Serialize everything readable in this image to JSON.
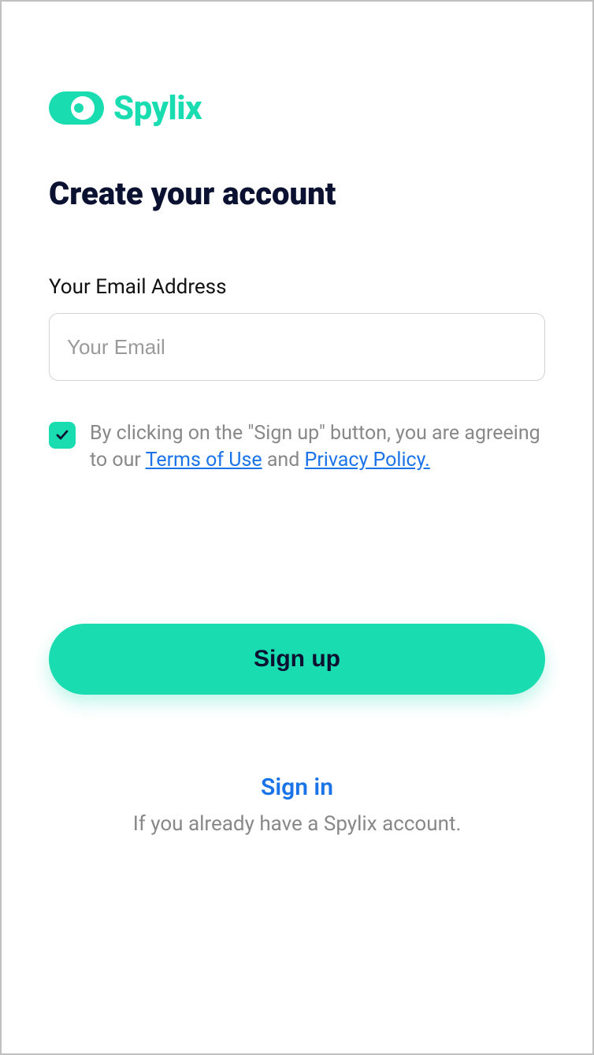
{
  "brand": {
    "name": "Spylix",
    "accent_color": "#1adcb1"
  },
  "heading": "Create your account",
  "email": {
    "label": "Your Email Address",
    "placeholder": "Your Email",
    "value": ""
  },
  "consent": {
    "checked": true,
    "text_prefix": "By clicking on the \"Sign up\" button, you are agreeing to our ",
    "terms_label": "Terms of Use",
    "and_label": " and ",
    "privacy_label": "Privacy Policy."
  },
  "signup_button": "Sign up",
  "signin": {
    "link_label": "Sign in",
    "subtext": "If you already have a Spylix account."
  },
  "link_color": "#1a73e8"
}
